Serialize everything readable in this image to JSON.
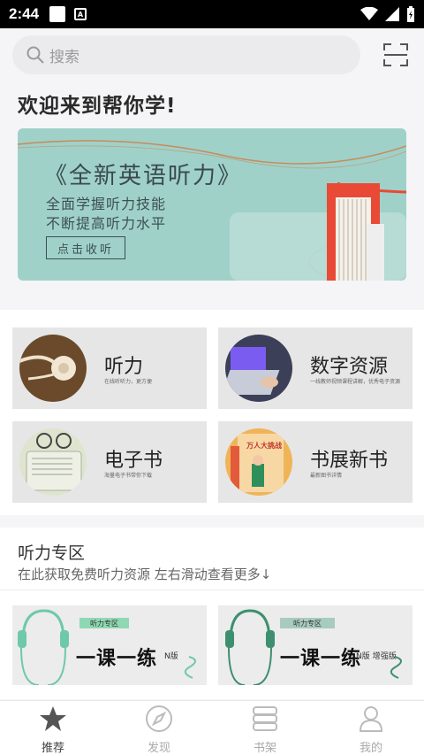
{
  "status_bar": {
    "time": "2:44",
    "a_icon": "A"
  },
  "search": {
    "placeholder": "搜索",
    "icon": "search-icon"
  },
  "welcome": "欢迎来到帮你学!",
  "banner": {
    "title": "《全新英语听力》",
    "line1": "全面学握听力技能",
    "line2": "不断提高听力水平",
    "button": "点击收听"
  },
  "categories": [
    {
      "title": "听力",
      "desc": "在线听听力，更方便"
    },
    {
      "title": "数字资源",
      "desc": "一线教师视频课程讲解，优秀电子资源"
    },
    {
      "title": "电子书",
      "desc": "海量电子书带你下载"
    },
    {
      "title": "书展新书",
      "desc": "最新图书详情"
    }
  ],
  "thumb_texts": {
    "book_cover": "万人大挑战"
  },
  "zone": {
    "title": "听力专区",
    "subtitle": "在此获取免费听力资源   左右滑动查看更多↓",
    "cards": [
      {
        "tag": "听力专区",
        "name": "一课一练",
        "edition": "N版"
      },
      {
        "tag": "听力专区",
        "name": "一课一练",
        "edition": "N版 增强版"
      }
    ]
  },
  "tabs": [
    {
      "label": "推荐",
      "icon": "star-icon",
      "active": true
    },
    {
      "label": "发现",
      "icon": "compass-icon",
      "active": false
    },
    {
      "label": "书架",
      "icon": "bookshelf-icon",
      "active": false
    },
    {
      "label": "我的",
      "icon": "person-icon",
      "active": false
    }
  ],
  "colors": {
    "banner_bg": "#9fd1c9",
    "accent_green": "#3d8f6f",
    "active_tab": "#444444"
  }
}
